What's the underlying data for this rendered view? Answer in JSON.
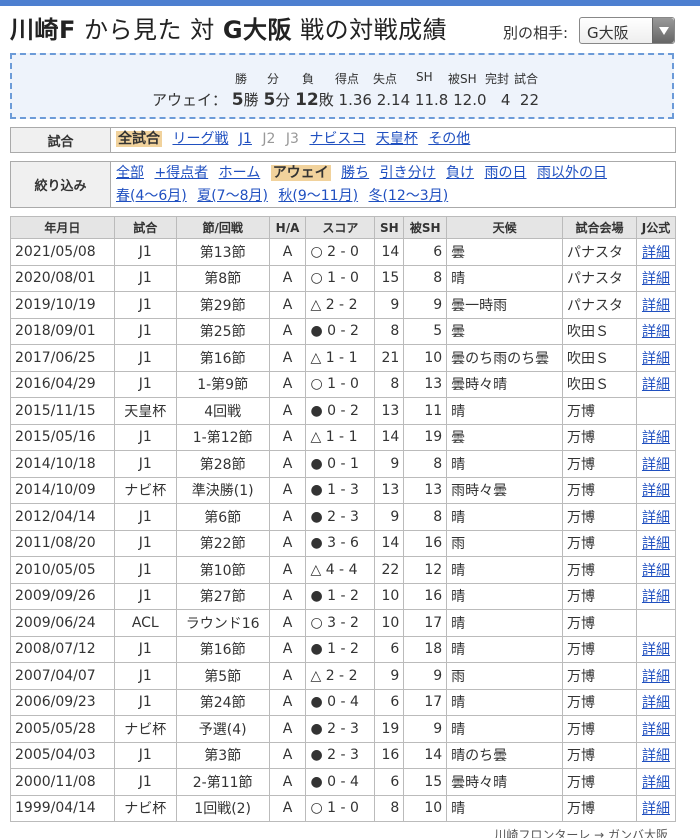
{
  "header": {
    "team": "川崎F",
    "from_text": "から見た",
    "vs_text": "対",
    "opponent": "G大阪",
    "suffix": "戦の対戦成績",
    "opponent_label": "別の相手:",
    "opponent_selected": "G大阪"
  },
  "summary": {
    "headers": [
      "勝",
      "分",
      "負",
      "得点",
      "失点",
      "SH",
      "被SH",
      "完封",
      "試合"
    ],
    "row_label": "アウェイ：",
    "wins": "5",
    "wins_unit": "勝",
    "draws": "5",
    "draws_unit": "分",
    "losses": "12",
    "losses_unit": "敗",
    "goals_for": "1.36",
    "goals_against": "2.14",
    "sh": "11.8",
    "opp_sh": "12.0",
    "clean_sheets": "4",
    "matches": "22"
  },
  "filters": {
    "match_label": "試合",
    "match_options": [
      {
        "label": "全試合",
        "state": "sel"
      },
      {
        "label": "リーグ戦",
        "state": "link"
      },
      {
        "label": "J1",
        "state": "link"
      },
      {
        "label": "J2",
        "state": "dis"
      },
      {
        "label": "J3",
        "state": "dis"
      },
      {
        "label": "ナビスコ",
        "state": "link"
      },
      {
        "label": "天皇杯",
        "state": "link"
      },
      {
        "label": "その他",
        "state": "link"
      }
    ],
    "narrow_label": "絞り込み",
    "narrow_options": [
      {
        "label": "全部",
        "state": "link"
      },
      {
        "label": "+得点者",
        "state": "link"
      },
      {
        "label": "ホーム",
        "state": "link"
      },
      {
        "label": "アウェイ",
        "state": "sel"
      },
      {
        "label": "勝ち",
        "state": "link"
      },
      {
        "label": "引き分け",
        "state": "link"
      },
      {
        "label": "負け",
        "state": "link"
      },
      {
        "label": "雨の日",
        "state": "link"
      },
      {
        "label": "雨以外の日",
        "state": "link"
      },
      {
        "label": "春(4〜6月)",
        "state": "link"
      },
      {
        "label": "夏(7〜8月)",
        "state": "link"
      },
      {
        "label": "秋(9〜11月)",
        "state": "link"
      },
      {
        "label": "冬(12〜3月)",
        "state": "link"
      }
    ]
  },
  "table": {
    "columns": [
      "年月日",
      "試合",
      "節/回戦",
      "H/A",
      "スコア",
      "SH",
      "被SH",
      "天候",
      "試合会場",
      "J公式"
    ],
    "detail_label": "詳細",
    "rows": [
      {
        "date": "2021/05/08",
        "comp": "J1",
        "round": "第13節",
        "ha": "A",
        "result": "○",
        "score": "2 - 0",
        "sh": "14",
        "osh": "6",
        "weather": "曇",
        "venue": "パナスタ",
        "detail": true
      },
      {
        "date": "2020/08/01",
        "comp": "J1",
        "round": "第8節",
        "ha": "A",
        "result": "○",
        "score": "1 - 0",
        "sh": "15",
        "osh": "8",
        "weather": "晴",
        "venue": "パナスタ",
        "detail": true
      },
      {
        "date": "2019/10/19",
        "comp": "J1",
        "round": "第29節",
        "ha": "A",
        "result": "△",
        "score": "2 - 2",
        "sh": "9",
        "osh": "9",
        "weather": "曇一時雨",
        "venue": "パナスタ",
        "detail": true
      },
      {
        "date": "2018/09/01",
        "comp": "J1",
        "round": "第25節",
        "ha": "A",
        "result": "●",
        "score": "0 - 2",
        "sh": "8",
        "osh": "5",
        "weather": "曇",
        "venue": "吹田Ｓ",
        "detail": true
      },
      {
        "date": "2017/06/25",
        "comp": "J1",
        "round": "第16節",
        "ha": "A",
        "result": "△",
        "score": "1 - 1",
        "sh": "21",
        "osh": "10",
        "weather": "曇のち雨のち曇",
        "venue": "吹田Ｓ",
        "detail": true
      },
      {
        "date": "2016/04/29",
        "comp": "J1",
        "round": "1-第9節",
        "ha": "A",
        "result": "○",
        "score": "1 - 0",
        "sh": "8",
        "osh": "13",
        "weather": "曇時々晴",
        "venue": "吹田Ｓ",
        "detail": true
      },
      {
        "date": "2015/11/15",
        "comp": "天皇杯",
        "round": "4回戦",
        "ha": "A",
        "result": "●",
        "score": "0 - 2",
        "sh": "13",
        "osh": "11",
        "weather": "晴",
        "venue": "万博",
        "detail": false
      },
      {
        "date": "2015/05/16",
        "comp": "J1",
        "round": "1-第12節",
        "ha": "A",
        "result": "△",
        "score": "1 - 1",
        "sh": "14",
        "osh": "19",
        "weather": "曇",
        "venue": "万博",
        "detail": true
      },
      {
        "date": "2014/10/18",
        "comp": "J1",
        "round": "第28節",
        "ha": "A",
        "result": "●",
        "score": "0 - 1",
        "sh": "9",
        "osh": "8",
        "weather": "晴",
        "venue": "万博",
        "detail": true
      },
      {
        "date": "2014/10/09",
        "comp": "ナビ杯",
        "round": "準決勝(1)",
        "ha": "A",
        "result": "●",
        "score": "1 - 3",
        "sh": "13",
        "osh": "13",
        "weather": "雨時々曇",
        "venue": "万博",
        "detail": true
      },
      {
        "date": "2012/04/14",
        "comp": "J1",
        "round": "第6節",
        "ha": "A",
        "result": "●",
        "score": "2 - 3",
        "sh": "9",
        "osh": "8",
        "weather": "晴",
        "venue": "万博",
        "detail": true
      },
      {
        "date": "2011/08/20",
        "comp": "J1",
        "round": "第22節",
        "ha": "A",
        "result": "●",
        "score": "3 - 6",
        "sh": "14",
        "osh": "16",
        "weather": "雨",
        "venue": "万博",
        "detail": true
      },
      {
        "date": "2010/05/05",
        "comp": "J1",
        "round": "第10節",
        "ha": "A",
        "result": "△",
        "score": "4 - 4",
        "sh": "22",
        "osh": "12",
        "weather": "晴",
        "venue": "万博",
        "detail": true
      },
      {
        "date": "2009/09/26",
        "comp": "J1",
        "round": "第27節",
        "ha": "A",
        "result": "●",
        "score": "1 - 2",
        "sh": "10",
        "osh": "16",
        "weather": "晴",
        "venue": "万博",
        "detail": true
      },
      {
        "date": "2009/06/24",
        "comp": "ACL",
        "round": "ラウンド16",
        "ha": "A",
        "result": "○",
        "score": "3 - 2",
        "sh": "10",
        "osh": "17",
        "weather": "晴",
        "venue": "万博",
        "detail": false
      },
      {
        "date": "2008/07/12",
        "comp": "J1",
        "round": "第16節",
        "ha": "A",
        "result": "●",
        "score": "1 - 2",
        "sh": "6",
        "osh": "18",
        "weather": "晴",
        "venue": "万博",
        "detail": true
      },
      {
        "date": "2007/04/07",
        "comp": "J1",
        "round": "第5節",
        "ha": "A",
        "result": "△",
        "score": "2 - 2",
        "sh": "9",
        "osh": "9",
        "weather": "雨",
        "venue": "万博",
        "detail": true
      },
      {
        "date": "2006/09/23",
        "comp": "J1",
        "round": "第24節",
        "ha": "A",
        "result": "●",
        "score": "0 - 4",
        "sh": "6",
        "osh": "17",
        "weather": "晴",
        "venue": "万博",
        "detail": true
      },
      {
        "date": "2005/05/28",
        "comp": "ナビ杯",
        "round": "予選(4)",
        "ha": "A",
        "result": "●",
        "score": "2 - 3",
        "sh": "19",
        "osh": "9",
        "weather": "晴",
        "venue": "万博",
        "detail": true
      },
      {
        "date": "2005/04/03",
        "comp": "J1",
        "round": "第3節",
        "ha": "A",
        "result": "●",
        "score": "2 - 3",
        "sh": "16",
        "osh": "14",
        "weather": "晴のち曇",
        "venue": "万博",
        "detail": true
      },
      {
        "date": "2000/11/08",
        "comp": "J1",
        "round": "2-第11節",
        "ha": "A",
        "result": "●",
        "score": "0 - 4",
        "sh": "6",
        "osh": "15",
        "weather": "曇時々晴",
        "venue": "万博",
        "detail": true
      },
      {
        "date": "1999/04/14",
        "comp": "ナビ杯",
        "round": "1回戦(2)",
        "ha": "A",
        "result": "○",
        "score": "1 - 0",
        "sh": "8",
        "osh": "10",
        "weather": "晴",
        "venue": "万博",
        "detail": true
      }
    ]
  },
  "footer": {
    "text": "川崎フロンターレ → ガンバ大阪"
  }
}
